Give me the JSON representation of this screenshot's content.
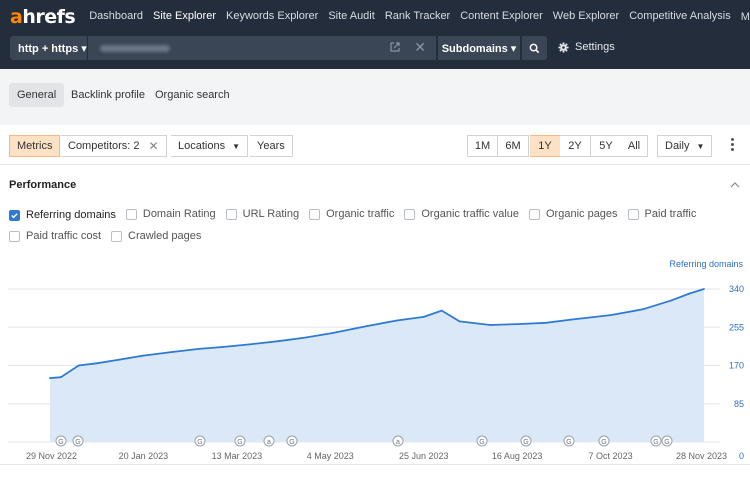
{
  "nav": {
    "logo_a": "a",
    "logo_rest": "hrefs",
    "links": [
      "Dashboard",
      "Site Explorer",
      "Keywords Explorer",
      "Site Audit",
      "Rank Tracker",
      "Content Explorer",
      "Web Explorer",
      "Competitive Analysis",
      "More ▾"
    ],
    "active": "Site Explorer"
  },
  "search": {
    "protocol": "http + https ▾",
    "mode": "Subdomains ▾",
    "settings": "Settings"
  },
  "tabs": [
    "General",
    "Backlink profile",
    "Organic search"
  ],
  "filters": {
    "metrics": "Metrics",
    "competitors": "Competitors: 2",
    "locations": "Locations",
    "years": "Years",
    "ranges": [
      "1M",
      "6M",
      "1Y",
      "2Y",
      "5Y",
      "All"
    ],
    "active_range": "1Y",
    "interval": "Daily"
  },
  "performance": {
    "title": "Performance",
    "metrics": [
      {
        "label": "Referring domains",
        "checked": true
      },
      {
        "label": "Domain Rating",
        "checked": false
      },
      {
        "label": "URL Rating",
        "checked": false
      },
      {
        "label": "Organic traffic",
        "checked": false
      },
      {
        "label": "Organic traffic value",
        "checked": false
      },
      {
        "label": "Organic pages",
        "checked": false
      },
      {
        "label": "Paid traffic",
        "checked": false
      },
      {
        "label": "Paid traffic cost",
        "checked": false
      },
      {
        "label": "Crawled pages",
        "checked": false
      }
    ]
  },
  "chart_data": {
    "type": "area",
    "series_name": "Referring domains",
    "x_labels": [
      "29 Nov 2022",
      "20 Jan 2023",
      "13 Mar 2023",
      "4 May 2023",
      "25 Jun 2023",
      "16 Aug 2023",
      "7 Oct 2023",
      "28 Nov 2023"
    ],
    "y_ticks": [
      0,
      85,
      170,
      255,
      340
    ],
    "ylim": [
      0,
      340
    ],
    "points": [
      [
        "29 Nov 2022",
        142
      ],
      [
        "5 Dec 2022",
        144
      ],
      [
        "15 Dec 2022",
        170
      ],
      [
        "25 Dec 2022",
        175
      ],
      [
        "5 Jan 2023",
        182
      ],
      [
        "20 Jan 2023",
        192
      ],
      [
        "5 Feb 2023",
        200
      ],
      [
        "20 Feb 2023",
        207
      ],
      [
        "5 Mar 2023",
        211
      ],
      [
        "20 Mar 2023",
        217
      ],
      [
        "5 Apr 2023",
        224
      ],
      [
        "20 Apr 2023",
        232
      ],
      [
        "5 May 2023",
        242
      ],
      [
        "25 May 2023",
        258
      ],
      [
        "10 Jun 2023",
        270
      ],
      [
        "25 Jun 2023",
        278
      ],
      [
        "5 Jul 2023",
        292
      ],
      [
        "15 Jul 2023",
        268
      ],
      [
        "1 Aug 2023",
        260
      ],
      [
        "16 Aug 2023",
        262
      ],
      [
        "1 Sep 2023",
        265
      ],
      [
        "15 Sep 2023",
        272
      ],
      [
        "7 Oct 2023",
        282
      ],
      [
        "25 Oct 2023",
        295
      ],
      [
        "10 Nov 2023",
        315
      ],
      [
        "20 Nov 2023",
        330
      ],
      [
        "28 Nov 2023",
        340
      ]
    ],
    "annotations": [
      "G",
      "G",
      "G",
      "G",
      "a",
      "G",
      "a",
      "G",
      "G",
      "G",
      "G",
      "G",
      "G"
    ],
    "colors": {
      "line": "#2f7bd3",
      "fill": "#dbe8f7",
      "grid": "#e3e6ea",
      "tick": "#2f6fc0"
    }
  }
}
